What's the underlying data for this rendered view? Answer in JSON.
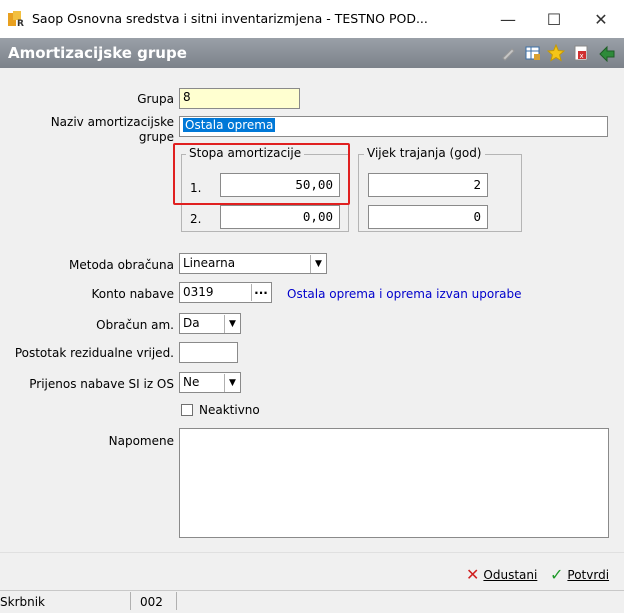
{
  "window": {
    "title": "Saop Osnovna sredstva i sitni inventarizmjena  - TESTNO POD...",
    "minimize": "—",
    "maximize": "☐",
    "close": "✕"
  },
  "form": {
    "title": "Amortizacijske grupe"
  },
  "fields": {
    "grupa_label": "Grupa",
    "grupa_value": "8",
    "naziv_label_1": "Naziv amortizacijske",
    "naziv_label_2": "grupe",
    "naziv_value": "Ostala oprema",
    "stopa_title": "Stopa amortizacije",
    "vijek_title": "Vijek trajanja (god)",
    "row1_label": "1.",
    "row1_stopa": "50,00",
    "row1_vijek": "2",
    "row2_label": "2.",
    "row2_stopa": "0,00",
    "row2_vijek": "0",
    "metoda_label": "Metoda obračuna",
    "metoda_value": "Linearna",
    "konto_label": "Konto nabave",
    "konto_value": "0319",
    "konto_btn": "...",
    "konto_desc": "Ostala oprema i oprema izvan uporabe",
    "obracun_label": "Obračun am.",
    "obracun_value": "Da",
    "postotak_label": "Postotak rezidualne vrijed.",
    "postotak_value": "",
    "prijenos_label": "Prijenos nabave SI iz OS",
    "prijenos_value": "Ne",
    "neaktivno_label": "Neaktivno",
    "napomene_label": "Napomene",
    "napomene_value": ""
  },
  "buttons": {
    "odustani": "Odustani",
    "potvrdi": "Potvrdi"
  },
  "status": {
    "user": "Skrbnik",
    "code": "002"
  },
  "colors": {
    "highlight": "#0078d7",
    "link": "#0000cc",
    "grupa_bg": "#ffffd0",
    "red_box": "#e02020"
  }
}
